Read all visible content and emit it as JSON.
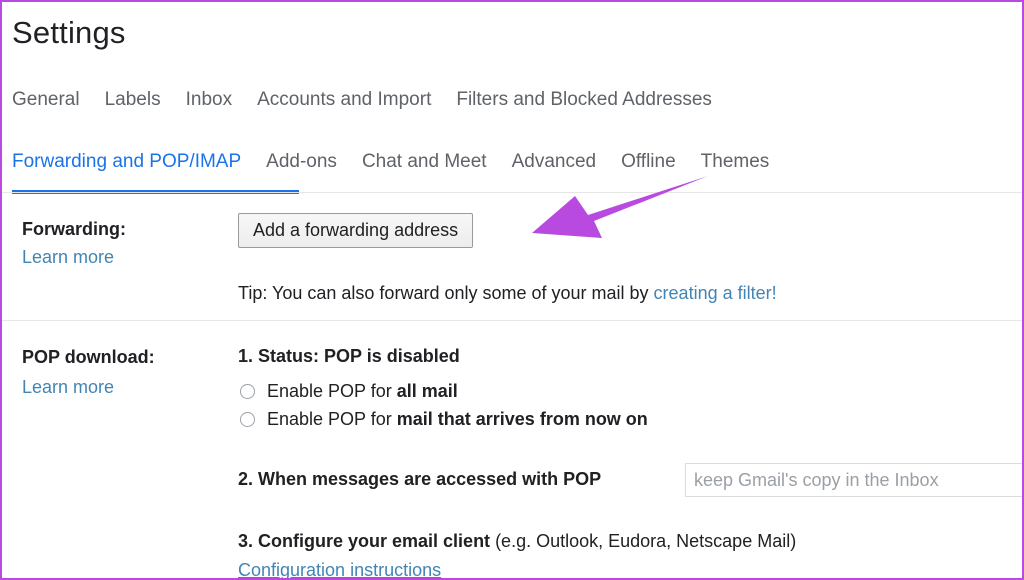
{
  "page": {
    "title": "Settings",
    "accent_blue": "#1a73e8",
    "link_blue": "#4285b4",
    "annotation_purple": "#b94ae0",
    "border_color": "#b94ae0"
  },
  "tabs_row1": [
    {
      "label": "General",
      "active": false
    },
    {
      "label": "Labels",
      "active": false
    },
    {
      "label": "Inbox",
      "active": false
    },
    {
      "label": "Accounts and Import",
      "active": false
    },
    {
      "label": "Filters and Blocked Addresses",
      "active": false
    }
  ],
  "tabs_row2": [
    {
      "label": "Forwarding and POP/IMAP",
      "active": true
    },
    {
      "label": "Add-ons",
      "active": false
    },
    {
      "label": "Chat and Meet",
      "active": false
    },
    {
      "label": "Advanced",
      "active": false
    },
    {
      "label": "Offline",
      "active": false
    },
    {
      "label": "Themes",
      "active": false
    }
  ],
  "forwarding": {
    "label": "Forwarding:",
    "learn_more": "Learn more",
    "add_button": "Add a forwarding address",
    "tip_prefix": "Tip: You can also forward only some of your mail by ",
    "tip_link": "creating a filter!"
  },
  "pop": {
    "label": "POP download:",
    "learn_more": "Learn more",
    "status": "1. Status: POP is disabled",
    "radio_1_prefix": "Enable POP for ",
    "radio_1_bold": "all mail",
    "radio_2_prefix": "Enable POP for ",
    "radio_2_bold": "mail that arrives from now on",
    "item2_label": "2. When messages are accessed with POP",
    "item2_select_value": "keep Gmail's copy in the Inbox",
    "item3_bold": "3. Configure your email client",
    "item3_rest": " (e.g. Outlook, Eudora, Netscape Mail)",
    "config_link": "Configuration instructions"
  },
  "annotation": {
    "arrow_label": "purple-arrow-pointing-to-add-forwarding-address-button",
    "color": "#b94ae0"
  }
}
